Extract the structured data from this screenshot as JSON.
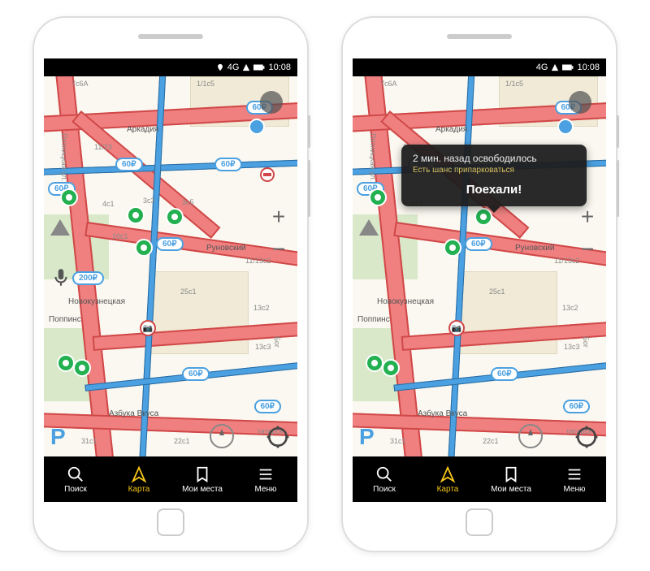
{
  "status": {
    "network": "4G",
    "time": "10:08"
  },
  "nav": {
    "search": "Поиск",
    "map": "Карта",
    "places": "Мои места",
    "menu": "Меню"
  },
  "tooltip": {
    "title": "2 мин. назад освободилось",
    "subtitle": "Есть шанс припарковаться",
    "action": "Поехали!"
  },
  "prices": {
    "p60": "60₽",
    "p200": "200₽"
  },
  "map_labels": {
    "l_7c6a": "7с6A",
    "l_1_1c5": "1/1с5",
    "arkadia": "Аркадия",
    "l_11_23": "11/23",
    "pyatnitskaya": "Пятницкая ул.",
    "l_4c1": "4с1",
    "l_3c3": "3с3",
    "l_3c5": "3с5",
    "l_10c1": "10с1",
    "runovsky": "Руновский",
    "l_25c1": "25с1",
    "l_13c2": "13с2",
    "l_11_13c2": "11/13с2",
    "novokuz": "Новокузнецкая",
    "poppins": "Поппинс",
    "l_13c3": "13с3",
    "bog": "Бог",
    "azbuka": "Азбука Вкуса",
    "l_31c1": "31с1",
    "l_22c1": "22с1",
    "tatarsk": "татарск"
  },
  "parking_symbol": "P"
}
